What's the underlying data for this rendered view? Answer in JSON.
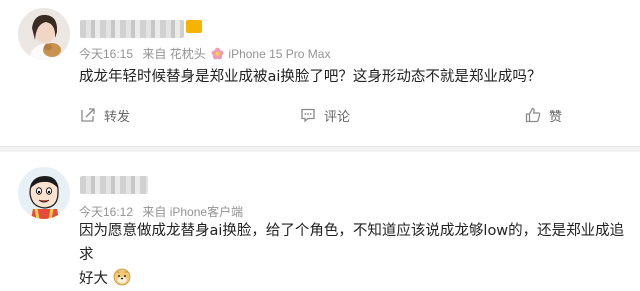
{
  "posts": [
    {
      "time": "今天16:15",
      "source": "来自 花枕头",
      "device": "iPhone 15 Pro Max",
      "text": "成龙年轻时候替身是郑业成被ai换脸了吧？这身形动态不就是郑业成吗？",
      "actions": {
        "share": "转发",
        "comment": "评论",
        "like": "赞"
      }
    },
    {
      "time": "今天16:12",
      "source": "来自 iPhone客户端",
      "text_line1": "因为愿意做成龙替身ai换脸，给了个角色，不知道应该说成龙够low的，还是郑业成追求",
      "text_line2": "好大"
    }
  ],
  "colors": {
    "meta": "#939393",
    "text": "#222222",
    "divider": "#f2f2f2",
    "vip": "#f5b400"
  },
  "icons": [
    "share-icon",
    "comment-icon",
    "like-icon",
    "flower-icon",
    "doge-emoji-icon"
  ]
}
